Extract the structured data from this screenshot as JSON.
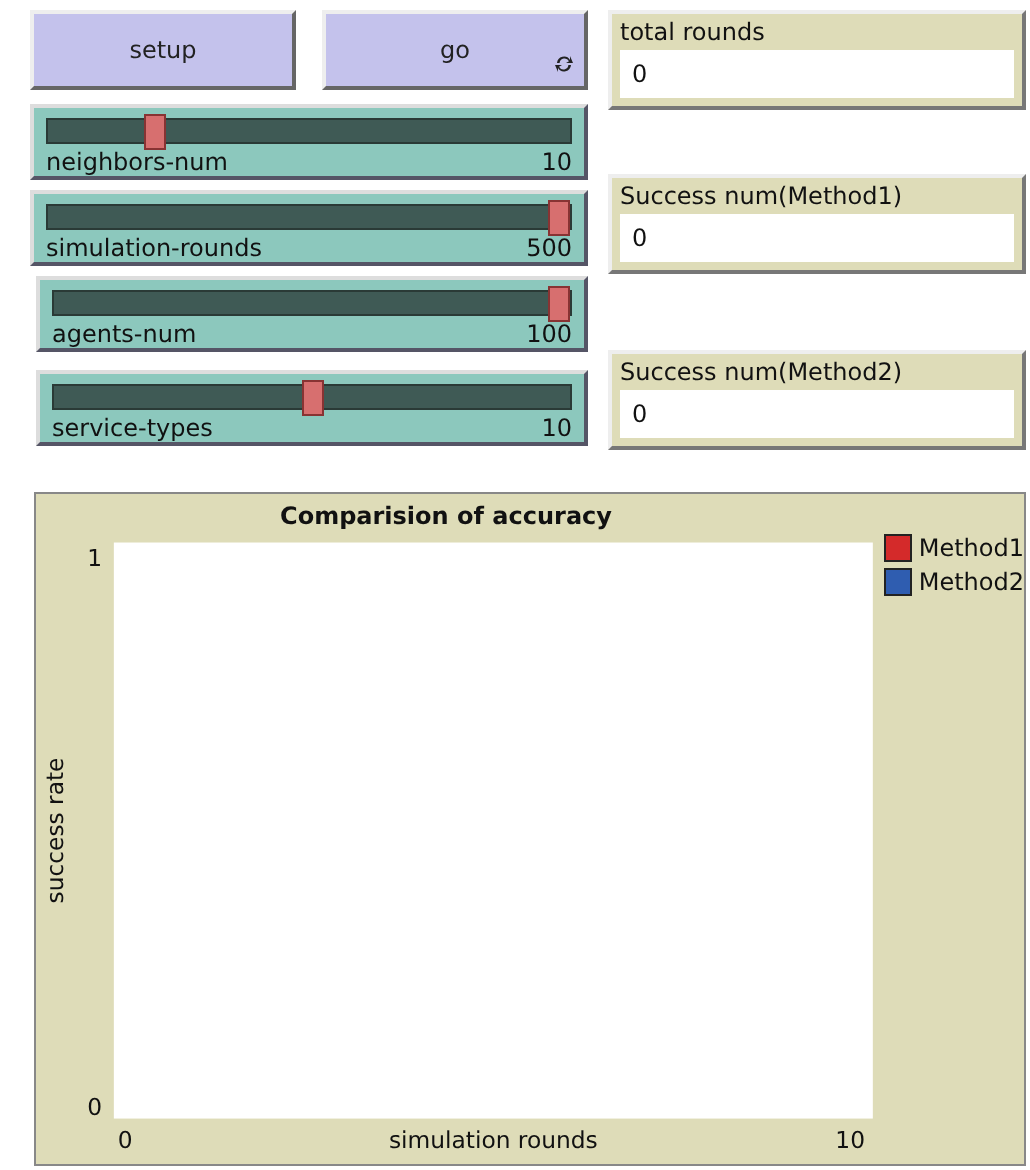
{
  "buttons": [
    {
      "label": "setup",
      "forever": false
    },
    {
      "label": "go",
      "forever": true
    }
  ],
  "sliders": [
    {
      "name": "neighbors-num",
      "level": 0.19,
      "reading": "10"
    },
    {
      "name": "simulation-rounds",
      "level": 1,
      "reading": "500"
    },
    {
      "name": "agents-num",
      "level": 1,
      "reading": "100"
    },
    {
      "name": "service-types",
      "level": 0.5,
      "reading": "10"
    }
  ],
  "monitors": [
    {
      "label": "total rounds",
      "value": "0"
    },
    {
      "label": "Success num(Method1)",
      "value": "0"
    },
    {
      "label": "Success num(Method2)",
      "value": "0"
    }
  ],
  "plot": {
    "title": "Comparision of accuracy",
    "ylabel": "success rate",
    "xlabel": "simulation rounds",
    "y_axis_labels": [
      "1",
      "0"
    ],
    "x_axis_labels": [
      "0",
      "10"
    ],
    "legend": [
      {
        "name": "Method1",
        "color": "#d42a2a"
      },
      {
        "name": "Method2",
        "color": "#2f5db0"
      }
    ]
  }
}
